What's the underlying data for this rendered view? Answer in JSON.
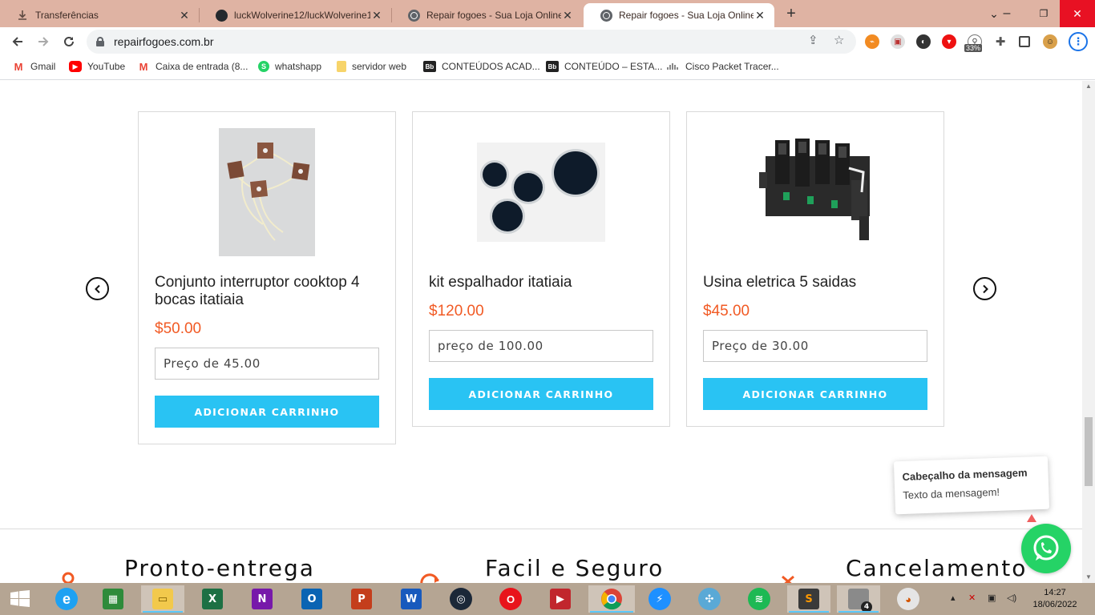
{
  "browser": {
    "tabs": [
      {
        "title": "Transferências",
        "icon": "download-icon",
        "active": false
      },
      {
        "title": "luckWolverine12/luckWolverine1",
        "icon": "github-icon",
        "active": false
      },
      {
        "title": "Repair fogoes - Sua Loja Online",
        "icon": "globe-icon",
        "active": false
      },
      {
        "title": "Repair fogoes - Sua Loja Online",
        "icon": "globe-icon",
        "active": true
      }
    ],
    "new_tab": "+",
    "url": "repairfogoes.com.br",
    "extension_badge": "33%",
    "bookmarks": [
      {
        "label": "Gmail",
        "icon": "gmail-icon"
      },
      {
        "label": "YouTube",
        "icon": "youtube-icon"
      },
      {
        "label": "Caixa de entrada (8...",
        "icon": "gmail-icon"
      },
      {
        "label": "whatshapp",
        "icon": "whatsapp-icon"
      },
      {
        "label": "servidor web",
        "icon": "folder-icon"
      },
      {
        "label": "CONTEÚDOS ACAD...",
        "icon": "blackboard-icon"
      },
      {
        "label": "CONTEÚDO – ESTA...",
        "icon": "blackboard-icon"
      },
      {
        "label": "Cisco Packet Tracer...",
        "icon": "cisco-icon"
      }
    ]
  },
  "products": [
    {
      "title": "Conjunto interruptor cooktop 4 bocas itatiaia",
      "price": "$50.00",
      "input_placeholder": "Preço de 45.00",
      "button": "ADICIONAR CARRINHO"
    },
    {
      "title": "kit espalhador itatiaia",
      "price": "$120.00",
      "input_placeholder": "preço de 100.00",
      "button": "ADICIONAR CARRINHO"
    },
    {
      "title": "Usina eletrica 5 saidas",
      "price": "$45.00",
      "input_placeholder": "Preço de 30.00",
      "button": "ADICIONAR CARRINHO"
    }
  ],
  "features": [
    {
      "label": "Pronto-entrega",
      "icon": "location-pin-icon"
    },
    {
      "label": "Facil e Seguro",
      "icon": "refresh-icon"
    },
    {
      "label": "Cancelamento",
      "icon": "cancel-icon"
    }
  ],
  "toast": {
    "header": "Cabeçalho da mensagem",
    "text": "Texto da mensagem!"
  },
  "colors": {
    "accent_button": "#29c3f3",
    "price": "#f15a24",
    "whatsapp": "#25d366",
    "tabstrip": "#dfb3a3"
  },
  "taskbar": {
    "apps": [
      "start-icon",
      "internet-explorer-icon",
      "microsoft-store-icon",
      "file-explorer-icon",
      "excel-icon",
      "onenote-icon",
      "outlook-icon",
      "powerpoint-icon",
      "word-icon",
      "steam-icon",
      "opera-icon",
      "video-player-icon",
      "chrome-icon",
      "messenger-icon",
      "game-controller-icon",
      "spotify-icon",
      "sublime-text-icon",
      "virtual-desktop-icon",
      "paint-icon"
    ],
    "virtual_desktop_badge": "4",
    "time": "14:27",
    "date": "18/06/2022"
  }
}
